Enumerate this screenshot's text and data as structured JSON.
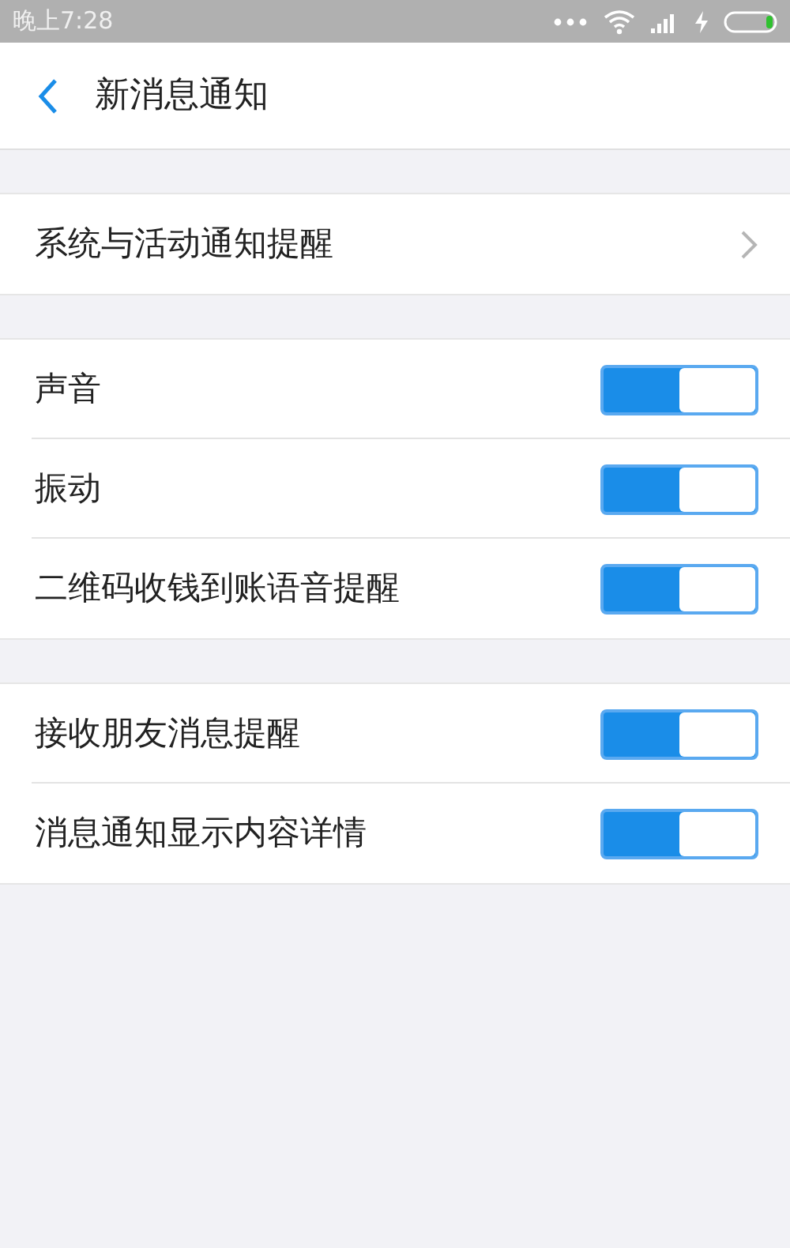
{
  "status_bar": {
    "time": "晚上7:28"
  },
  "header": {
    "title": "新消息通知"
  },
  "groups": [
    {
      "items": [
        {
          "kind": "link",
          "label": "系统与活动通知提醒"
        }
      ]
    },
    {
      "items": [
        {
          "kind": "toggle",
          "label": "声音",
          "on": true
        },
        {
          "kind": "toggle",
          "label": "振动",
          "on": true
        },
        {
          "kind": "toggle",
          "label": "二维码收钱到账语音提醒",
          "on": true
        }
      ]
    },
    {
      "items": [
        {
          "kind": "toggle",
          "label": "接收朋友消息提醒",
          "on": true
        },
        {
          "kind": "toggle",
          "label": "消息通知显示内容详情",
          "on": true
        }
      ]
    }
  ]
}
